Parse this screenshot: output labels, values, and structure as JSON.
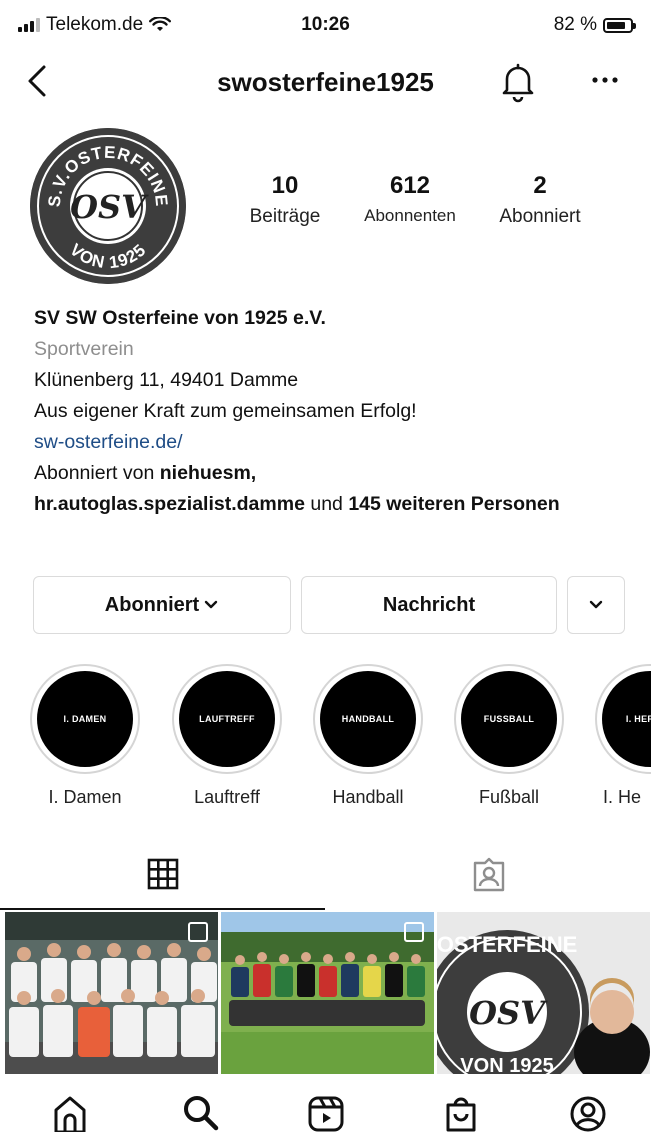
{
  "status_bar": {
    "carrier": "Telekom.de",
    "time": "10:26",
    "battery": "82 %",
    "battery_level": 0.82
  },
  "header": {
    "username": "swosterfeine1925",
    "icons": [
      "back-chevron-icon",
      "bell-icon",
      "more-icon"
    ]
  },
  "avatar": {
    "top_text": "S.V.OSTERFEINE",
    "bottom_text": "VON 1925",
    "monogram": "OSV"
  },
  "stats": [
    {
      "value": "10",
      "label": "Beiträge"
    },
    {
      "value": "612",
      "label": "Abonnenten"
    },
    {
      "value": "2",
      "label": "Abonniert"
    }
  ],
  "bio": {
    "name": "SV SW Osterfeine von 1925 e.V.",
    "category": "Sportverein",
    "address": "Klünenberg 11, 49401 Damme",
    "slogan": "Aus eigener Kraft zum gemeinsamen Erfolg!",
    "link": "sw-osterfeine.de/",
    "followed_by_prefix": "Abonniert von ",
    "followed_by_user1": "niehuesm,",
    "followed_by_user2": "hr.autoglas.spezialist.damme",
    "followed_by_and": " und ",
    "followed_by_count": "145 weiteren Personen"
  },
  "buttons": {
    "follow": "Abonniert",
    "message": "Nachricht"
  },
  "highlights": [
    {
      "cover": "I. DAMEN",
      "label": "I. Damen"
    },
    {
      "cover": "LAUFTREFF",
      "label": "Lauftreff"
    },
    {
      "cover": "HANDBALL",
      "label": "Handball"
    },
    {
      "cover": "FUSSBALL",
      "label": "Fußball"
    },
    {
      "cover": "I. HERREN",
      "label": "I. He"
    }
  ],
  "tabs": [
    "grid-icon",
    "tagged-icon"
  ],
  "posts": [
    {
      "type": "team-photo",
      "multiple": true
    },
    {
      "type": "team-photo-outdoor",
      "multiple": true
    },
    {
      "type": "logo-portrait",
      "multiple": false
    }
  ],
  "nav": [
    "home-icon",
    "search-icon",
    "reels-icon",
    "shop-icon",
    "profile-icon"
  ],
  "colors": {
    "link": "#1f4d86",
    "secondary_text": "#8e8e8e",
    "border": "#dbdbdb"
  }
}
